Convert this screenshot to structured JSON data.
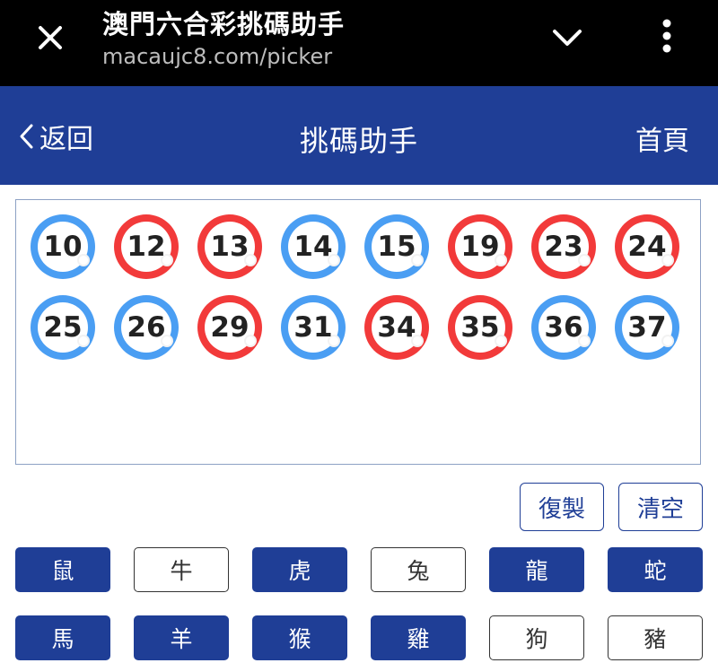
{
  "browser": {
    "title": "澳門六合彩挑碼助手",
    "url": "macaujc8.com/picker"
  },
  "header": {
    "back_label": "返回",
    "title": "挑碼助手",
    "home_label": "首頁",
    "color": "#1f3e96"
  },
  "balls": [
    {
      "number": "10",
      "color": "blue"
    },
    {
      "number": "12",
      "color": "red"
    },
    {
      "number": "13",
      "color": "red"
    },
    {
      "number": "14",
      "color": "blue"
    },
    {
      "number": "15",
      "color": "blue"
    },
    {
      "number": "19",
      "color": "red"
    },
    {
      "number": "23",
      "color": "red"
    },
    {
      "number": "24",
      "color": "red"
    },
    {
      "number": "25",
      "color": "blue"
    },
    {
      "number": "26",
      "color": "blue"
    },
    {
      "number": "29",
      "color": "red"
    },
    {
      "number": "31",
      "color": "blue"
    },
    {
      "number": "34",
      "color": "red"
    },
    {
      "number": "35",
      "color": "red"
    },
    {
      "number": "36",
      "color": "blue"
    },
    {
      "number": "37",
      "color": "blue"
    }
  ],
  "actions": {
    "copy_label": "復製",
    "clear_label": "清空"
  },
  "zodiac": [
    {
      "label": "鼠",
      "selected": true
    },
    {
      "label": "牛",
      "selected": false
    },
    {
      "label": "虎",
      "selected": true
    },
    {
      "label": "兔",
      "selected": false
    },
    {
      "label": "龍",
      "selected": true
    },
    {
      "label": "蛇",
      "selected": true
    },
    {
      "label": "馬",
      "selected": true
    },
    {
      "label": "羊",
      "selected": true
    },
    {
      "label": "猴",
      "selected": true
    },
    {
      "label": "雞",
      "selected": true
    },
    {
      "label": "狗",
      "selected": false
    },
    {
      "label": "豬",
      "selected": false
    }
  ],
  "colors": {
    "red_ball": "#f23a3a",
    "blue_ball": "#4a9ef3",
    "accent": "#1f3e96"
  },
  "icons": {
    "close": "close-icon",
    "chevron": "chevron-down-icon",
    "menu": "more-vertical-icon",
    "back": "chevron-left-icon"
  }
}
